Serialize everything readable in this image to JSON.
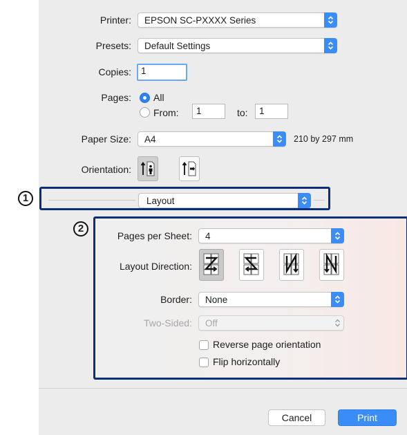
{
  "printer": {
    "label": "Printer:",
    "value": "EPSON SC-PXXXX Series"
  },
  "presets": {
    "label": "Presets:",
    "value": "Default Settings"
  },
  "copies": {
    "label": "Copies:",
    "value": "1"
  },
  "pages": {
    "label": "Pages:",
    "all_label": "All",
    "from_label": "From:",
    "from_value": "1",
    "to_label": "to:",
    "to_value": "1",
    "selected": "All"
  },
  "paper_size": {
    "label": "Paper Size:",
    "value": "A4",
    "dimensions": "210 by 297 mm"
  },
  "orientation": {
    "label": "Orientation:",
    "selected": "portrait"
  },
  "section": {
    "value": "Layout"
  },
  "layout": {
    "pages_per_sheet_label": "Pages per Sheet:",
    "pages_per_sheet_value": "4",
    "layout_direction_label": "Layout Direction:",
    "layout_direction_selected": 0,
    "border_label": "Border:",
    "border_value": "None",
    "two_sided_label": "Two-Sided:",
    "two_sided_value": "Off",
    "reverse_label": "Reverse page orientation",
    "flip_label": "Flip horizontally"
  },
  "callouts": {
    "one": "1",
    "two": "2"
  },
  "buttons": {
    "cancel": "Cancel",
    "print": "Print"
  },
  "colors": {
    "accent": "#3a8df7",
    "callout_border": "#0b2f78"
  }
}
